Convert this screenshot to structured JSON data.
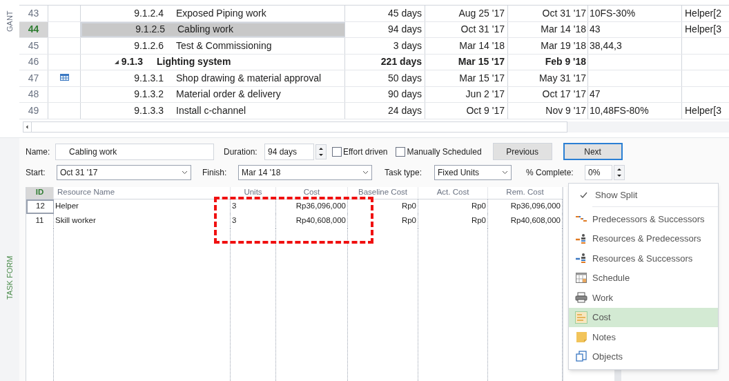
{
  "gantt": {
    "side_label": "GANT",
    "rows": [
      {
        "id": "43",
        "indicator": false,
        "kind": "task",
        "wbs": "9.1.2.4",
        "name": "Exposed Piping work",
        "duration": "45 days",
        "start": "Aug 25 '17",
        "finish": "Oct 31 '17",
        "predecessors": "10FS-30%",
        "resources": "Helper[2",
        "selected": false
      },
      {
        "id": "44",
        "indicator": false,
        "kind": "task",
        "wbs": "9.1.2.5",
        "name": "Cabling work",
        "duration": "94 days",
        "start": "Oct 31 '17",
        "finish": "Mar 14 '18",
        "predecessors": "43",
        "resources": "Helper[3",
        "selected": true
      },
      {
        "id": "45",
        "indicator": false,
        "kind": "task",
        "wbs": "9.1.2.6",
        "name": "Test & Commissioning",
        "duration": "3 days",
        "start": "Mar 14 '18",
        "finish": "Mar 19 '18",
        "predecessors": "38,44,3",
        "selected": false
      },
      {
        "id": "46",
        "indicator": false,
        "kind": "summary",
        "expanded": true,
        "wbs": "9.1.3",
        "name": "Lighting system",
        "duration": "221 days",
        "start": "Mar 15 '17",
        "finish": "Feb 9 '18",
        "selected": false
      },
      {
        "id": "47",
        "indicator": true,
        "kind": "task",
        "wbs": "9.1.3.1",
        "name": "Shop drawing & material approval",
        "duration": "50 days",
        "start": "Mar 15 '17",
        "finish": "May 31 '17",
        "selected": false
      },
      {
        "id": "48",
        "indicator": false,
        "kind": "task",
        "wbs": "9.1.3.2",
        "name": "Material order & delivery",
        "duration": "90 days",
        "start": "Jun 2 '17",
        "finish": "Oct 17 '17",
        "predecessors": "47",
        "selected": false
      },
      {
        "id": "49",
        "indicator": false,
        "kind": "task",
        "wbs": "9.1.3.3",
        "name": "Install c-channel",
        "duration": "24 days",
        "start": "Oct 9 '17",
        "finish": "Nov 9 '17",
        "predecessors": "10,48FS-80%",
        "resources": "Helper[3",
        "selected": false
      }
    ]
  },
  "task_form": {
    "side_label": "TASK FORM",
    "name": {
      "label": "Name:",
      "value": "Cabling work"
    },
    "duration": {
      "label": "Duration:",
      "value": "94 days"
    },
    "checkboxes": [
      {
        "label": "Effort driven",
        "checked": false
      },
      {
        "label": "Manually Scheduled",
        "checked": false
      }
    ],
    "buttons": [
      {
        "label": "Previous",
        "focused": false
      },
      {
        "label": "Next",
        "focused": true
      }
    ],
    "start": {
      "label": "Start:",
      "value": "Oct 31 '17"
    },
    "finish": {
      "label": "Finish:",
      "value": "Mar 14 '18"
    },
    "task_type": {
      "label": "Task type:",
      "value": "Fixed Units"
    },
    "percent_complete": {
      "label": "% Complete:",
      "value": "0%"
    },
    "table": {
      "columns": [
        "ID",
        "Resource Name",
        "Units",
        "Cost",
        "Baseline Cost",
        "Act. Cost",
        "Rem. Cost"
      ],
      "rows": [
        {
          "cells": [
            "12",
            "Helper",
            "3",
            "Rp36,096,000",
            "Rp0",
            "Rp0",
            "Rp36,096,000"
          ],
          "selected": true
        },
        {
          "cells": [
            "11",
            "Skill worker",
            "3",
            "Rp40,608,000",
            "Rp0",
            "Rp0",
            "Rp40,608,000"
          ],
          "selected": false
        }
      ]
    }
  },
  "context_menu": {
    "toggle": {
      "label": "Show Split",
      "checked": true
    },
    "items": [
      {
        "label": "Predecessors & Successors",
        "selected": false
      },
      {
        "label": "Resources & Predecessors",
        "selected": false
      },
      {
        "label": "Resources & Successors",
        "selected": false
      },
      {
        "label": "Schedule",
        "selected": false
      },
      {
        "label": "Work",
        "selected": false
      },
      {
        "label": "Cost",
        "selected": true
      },
      {
        "label": "Notes",
        "selected": false
      },
      {
        "label": "Objects",
        "selected": false
      }
    ]
  }
}
